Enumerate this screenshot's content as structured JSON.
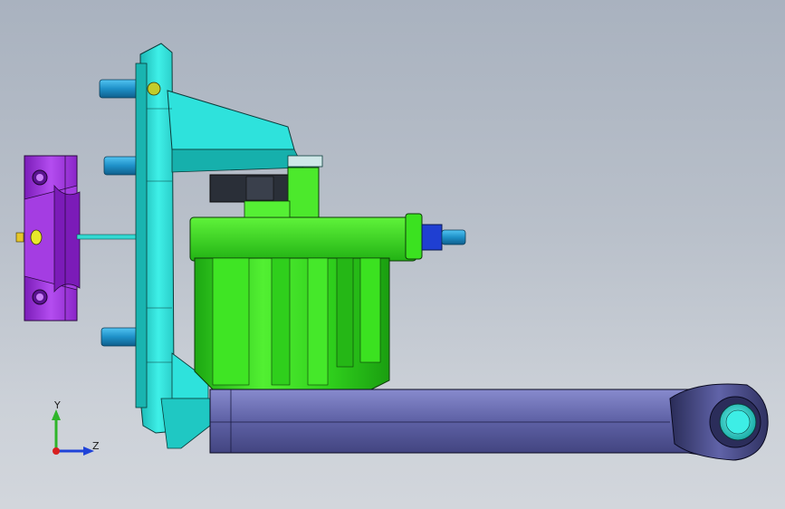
{
  "viewport": {
    "colors": {
      "bg_top": "#a9b2bf",
      "bg_bottom": "#d2d6dc",
      "cyan_part": "#23d8d2",
      "green_part": "#38dd1d",
      "purple_part": "#9b2fd8",
      "lever_part": "#5c5f9e",
      "blue_pins": "#1e90c8",
      "edge": "#101010"
    }
  },
  "parts": {
    "mounting_plate": "cyan",
    "motor_housing": "green",
    "connector_clip": "purple",
    "crank_arm": "navy",
    "shaft_pin": "cyan"
  },
  "triad": {
    "y_label": "Y",
    "z_label": "Z",
    "x_icon": "x-axis-dot-icon"
  }
}
